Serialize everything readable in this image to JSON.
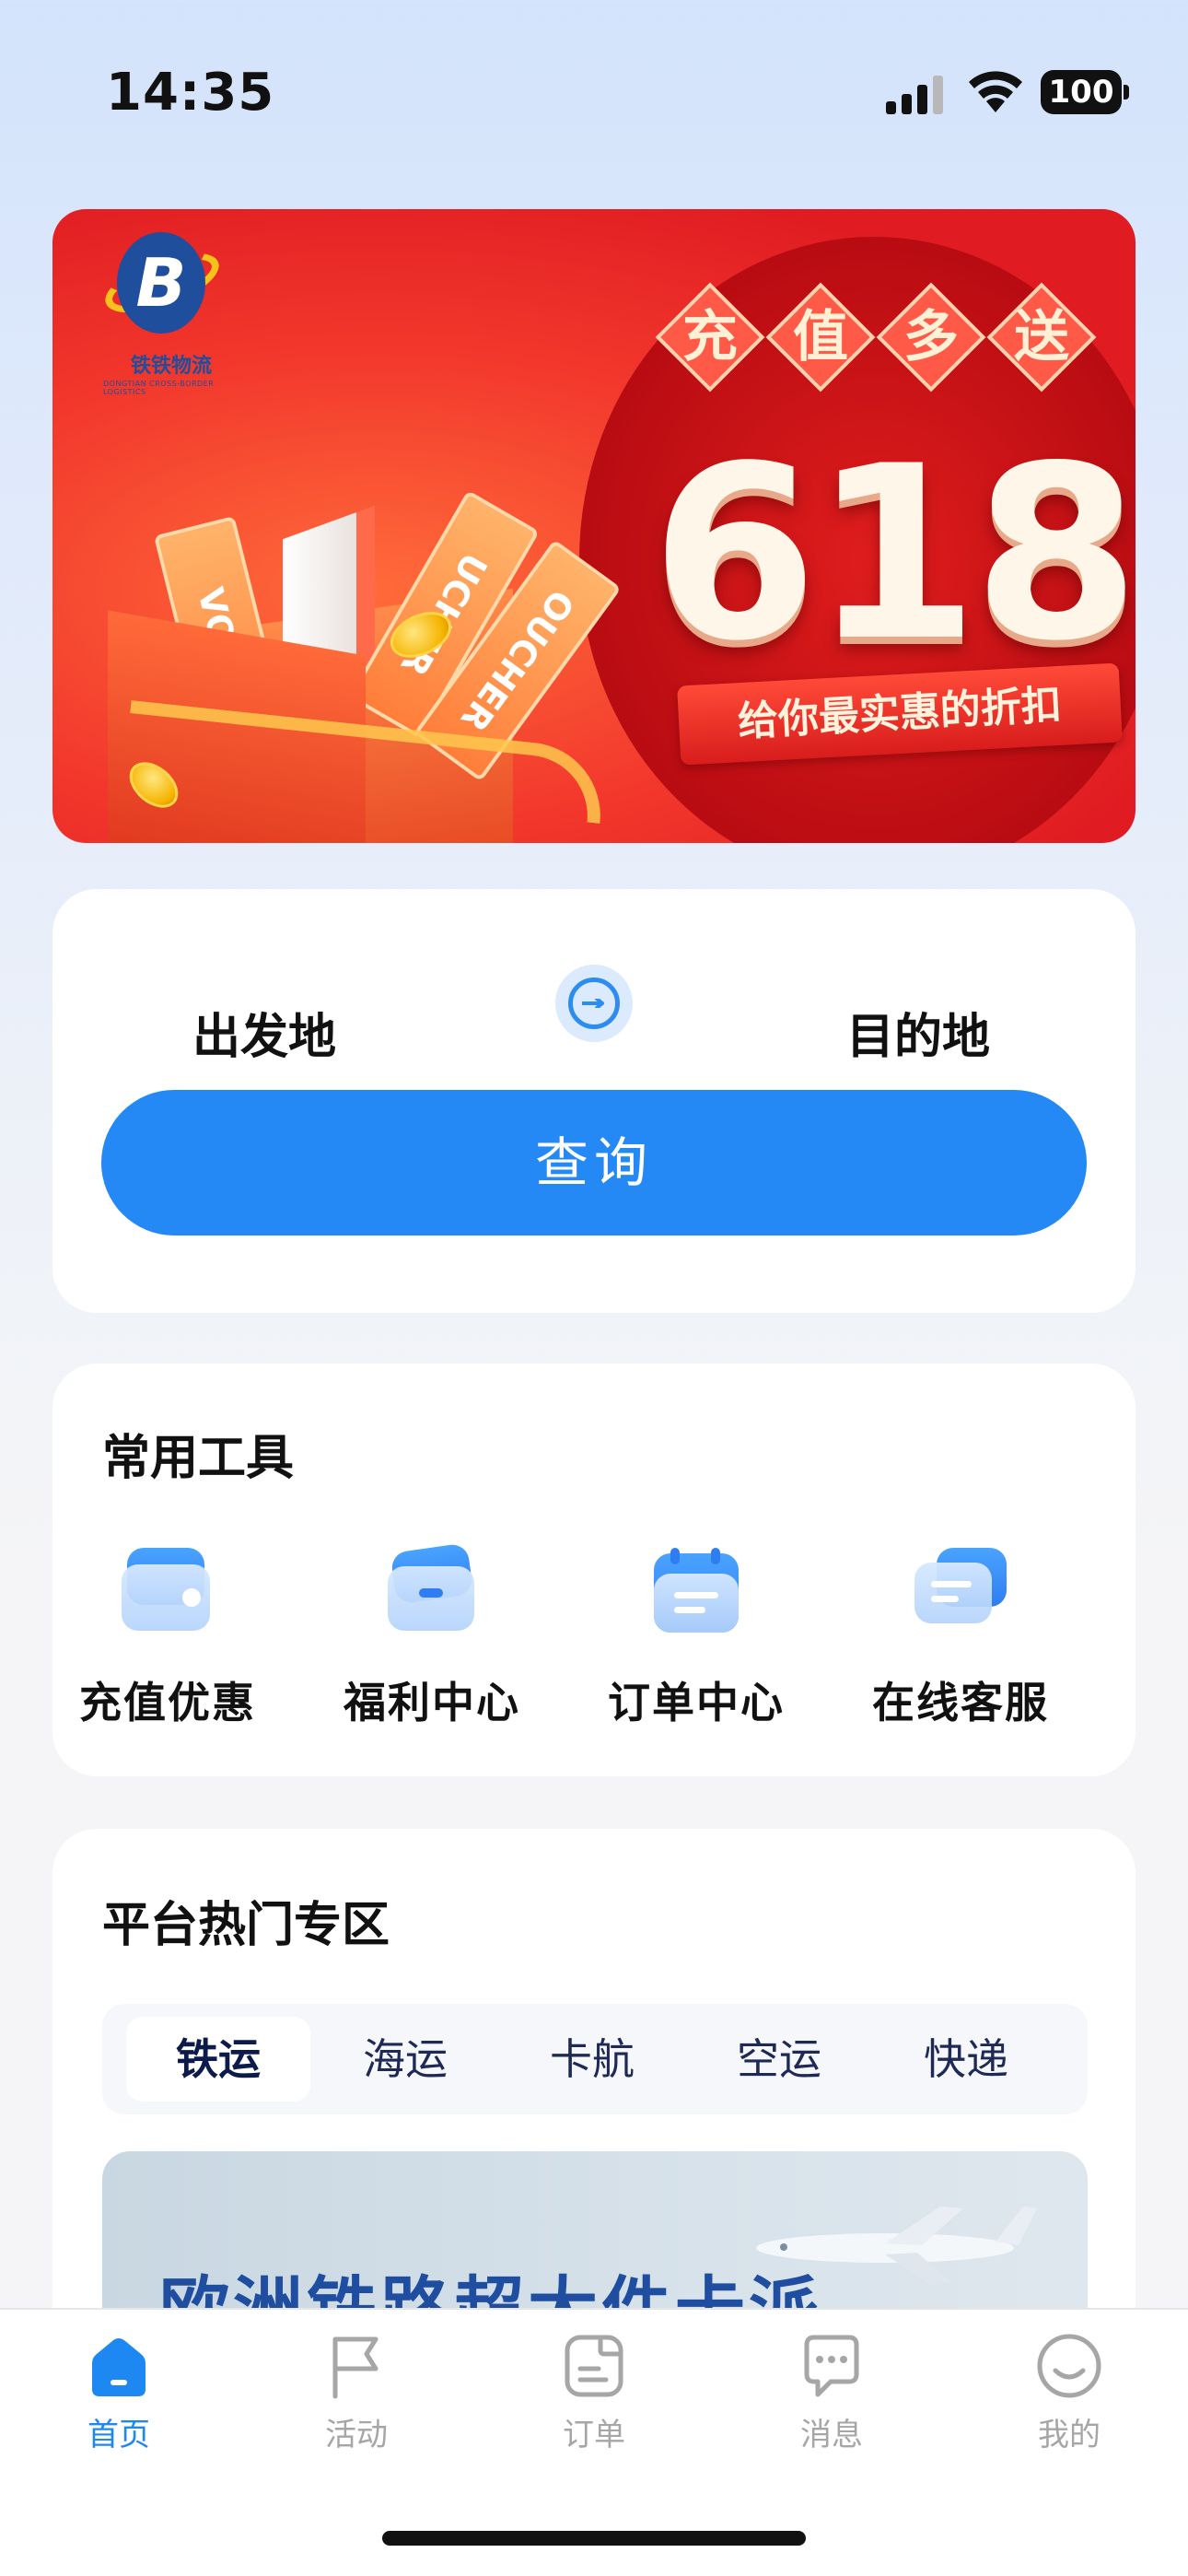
{
  "status_bar": {
    "time": "14:35",
    "battery": "100"
  },
  "banner": {
    "badge_chars": [
      "充",
      "值",
      "多",
      "送"
    ],
    "big_number": "618",
    "slogan": "给你最实惠的折扣",
    "logo_name": "铁铁物流",
    "logo_sub": "DONGTIAN CROSS-BORDER LOGISTICS",
    "voucher_text": [
      "VOUC",
      "UCHER",
      "OUCHER"
    ],
    "page_count": 4,
    "active_page": 1
  },
  "search": {
    "origin": "出发地",
    "destination": "目的地",
    "query_button": "查询"
  },
  "tools": {
    "title": "常用工具",
    "items": [
      {
        "label": "充值优惠",
        "icon": "wallet-icon"
      },
      {
        "label": "福利中心",
        "icon": "gift-card-icon"
      },
      {
        "label": "订单中心",
        "icon": "calendar-order-icon"
      },
      {
        "label": "在线客服",
        "icon": "chat-support-icon"
      }
    ]
  },
  "hot_zone": {
    "title": "平台热门专区",
    "tabs": [
      "铁运",
      "海运",
      "卡航",
      "空运",
      "快递"
    ],
    "active_tab": 0,
    "banner_text": "欧洲铁路超大件卡派"
  },
  "tab_bar": {
    "items": [
      {
        "label": "首页",
        "icon": "home-icon",
        "active": true
      },
      {
        "label": "活动",
        "icon": "flag-icon",
        "active": false
      },
      {
        "label": "订单",
        "icon": "order-icon",
        "active": false
      },
      {
        "label": "消息",
        "icon": "message-icon",
        "active": false
      },
      {
        "label": "我的",
        "icon": "profile-icon",
        "active": false
      }
    ]
  },
  "colors": {
    "accent": "#2489f5",
    "banner_red": "#e01c22",
    "active_tab": "#1e88f2",
    "inactive_tab": "#a6a6a6"
  }
}
